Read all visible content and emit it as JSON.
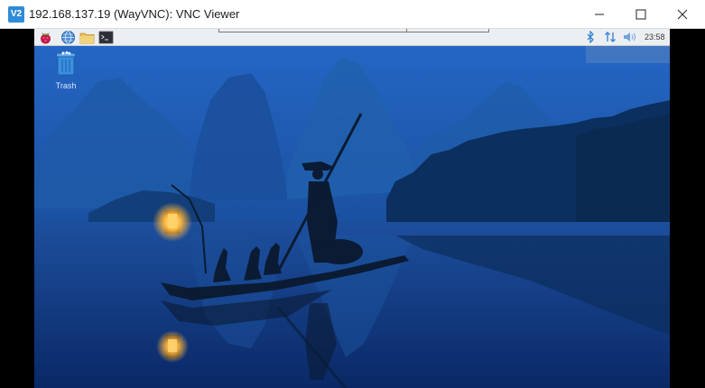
{
  "window": {
    "title": "192.168.137.19 (WayVNC): VNC Viewer",
    "app_icon_text": "V2",
    "buttons": [
      "minimize",
      "maximize",
      "close"
    ]
  },
  "panel": {
    "launchers": [
      "raspberry-menu-icon",
      "web-browser-icon",
      "file-manager-icon",
      "terminal-icon"
    ],
    "tray": [
      "bluetooth-icon",
      "network-transfer-icon",
      "volume-icon"
    ],
    "clock": "23:58"
  },
  "desktop": {
    "icons": [
      {
        "name": "trash-icon",
        "label": "Trash"
      }
    ]
  },
  "colors": {
    "accent": "#2f8bd6",
    "panel_bg": "#eceff2",
    "wallpaper_top": "#1f5fb5",
    "wallpaper_bottom": "#0c2f74"
  }
}
